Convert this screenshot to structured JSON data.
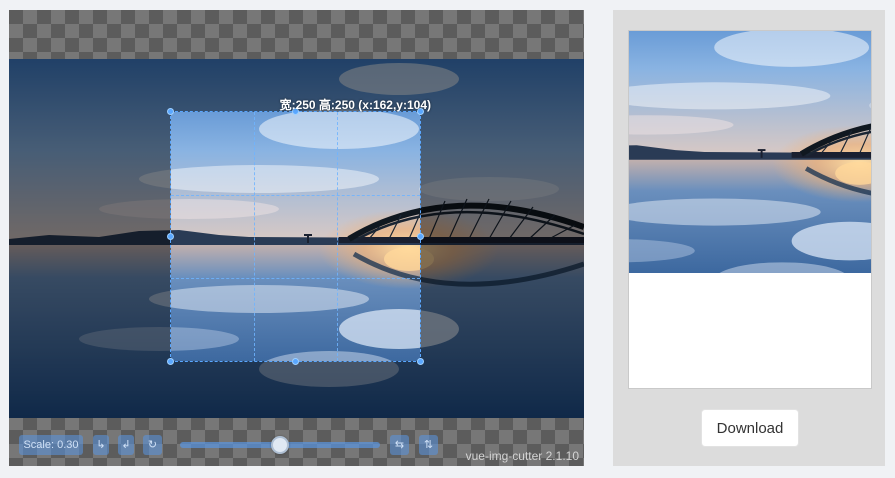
{
  "cutter": {
    "selection_label": "宽:250 高:250 (x:162,y:104)",
    "version": "vue-img-cutter 2.1.10",
    "toolbar": {
      "scale_label": "Scale: 0.30",
      "rotate_left_glyph": "↳",
      "rotate_right_glyph": "↲",
      "reset_glyph": "↻",
      "flip_horizontal_glyph": "⇆",
      "flip_vertical_glyph": "⇅",
      "zoom_level": 0.5
    }
  },
  "preview": {
    "download_label": "Download"
  },
  "colors": {
    "accent": "#5aa7ff",
    "toolbar_button": "#5a96e1"
  }
}
